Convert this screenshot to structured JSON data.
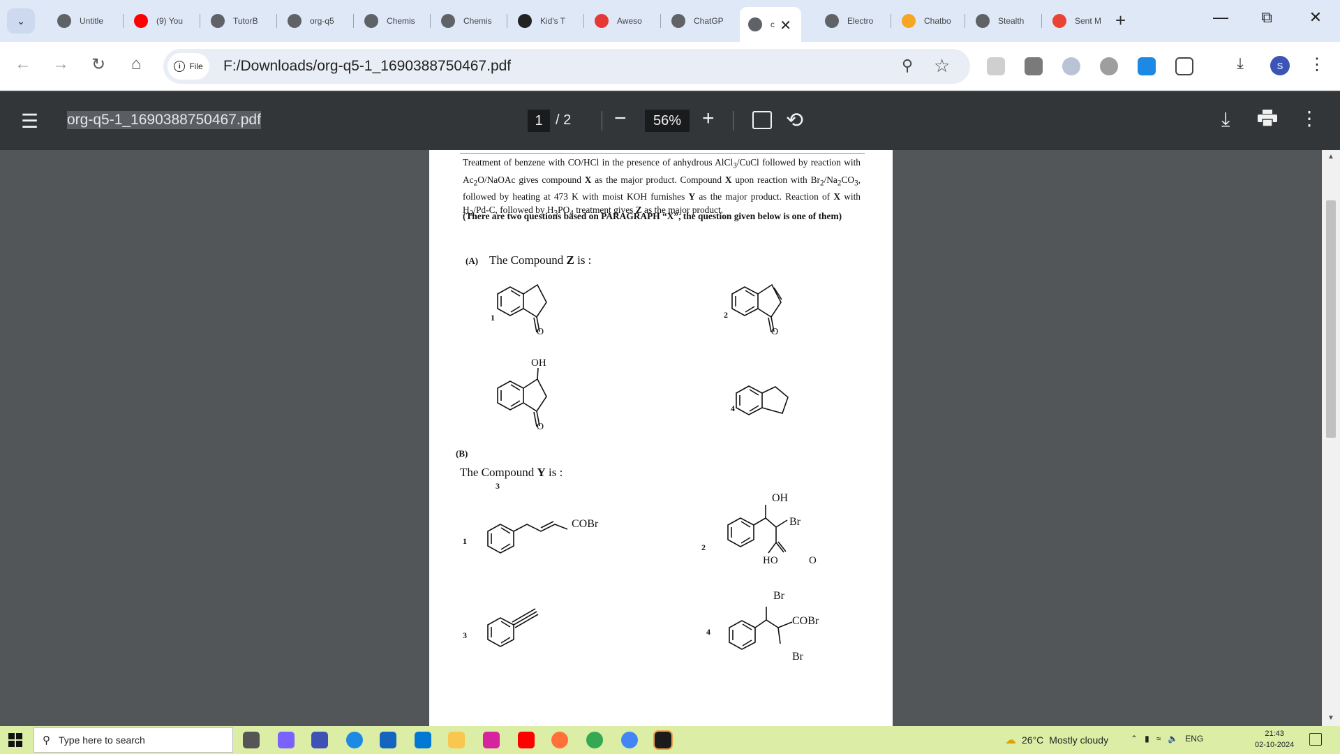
{
  "browser": {
    "tabs": [
      {
        "label": "Untitle",
        "icon": "globe-icon",
        "color": "#5f6368"
      },
      {
        "label": "(9) You",
        "icon": "youtube-icon",
        "color": "#ff0000"
      },
      {
        "label": "TutorB",
        "icon": "tutor-icon",
        "color": "#5f6368"
      },
      {
        "label": "org-q5",
        "icon": "globe-icon",
        "color": "#5f6368"
      },
      {
        "label": "Chemis",
        "icon": "globe-icon",
        "color": "#5f6368"
      },
      {
        "label": "Chemis",
        "icon": "globe-icon",
        "color": "#5f6368"
      },
      {
        "label": "Kid's T",
        "icon": "kids-icon",
        "color": "#222222"
      },
      {
        "label": "Aweso",
        "icon": "awesome-icon",
        "color": "#e53935"
      },
      {
        "label": "ChatGP",
        "icon": "openai-icon",
        "color": "#5f6368"
      },
      {
        "label": "c",
        "icon": "globe-icon",
        "color": "#5f6368"
      },
      {
        "label": "Electro",
        "icon": "globe-icon",
        "color": "#5f6368"
      },
      {
        "label": "Chatbo",
        "icon": "chatbot-icon",
        "color": "#f5a623"
      },
      {
        "label": "Stealth",
        "icon": "stealth-icon",
        "color": "#5f6368"
      },
      {
        "label": "Sent M",
        "icon": "gmail-icon",
        "color": "#ea4335"
      }
    ],
    "active_tab_close": "✕",
    "new_tab": "+",
    "site_info_label": "File",
    "url": "F:/Downloads/org-q5-1_1690388750467.pdf",
    "profile_initial": "S"
  },
  "pdf_viewer": {
    "filename": "org-q5-1_1690388750467.pdf",
    "page_current": "1",
    "page_total": "/ 2",
    "zoom": "56%"
  },
  "document": {
    "paragraph_html": "Treatment of benzene with CO/HCl in the presence of anhydrous AlCl<sub>3</sub>/CuCl followed by reaction with Ac<sub>2</sub>O/NaOAc gives compound <b>X</b> as the major product. Compound <b>X</b> upon reaction with Br<sub>2</sub>/Na<sub>2</sub>CO<sub>3</sub>, followed by heating at 473 K with moist KOH furnishes <b>Y</b> as the major product. Reaction of <b>X</b> with H<sub>2</sub>/Pd-C, followed by H<sub>3</sub>PO<sub>4</sub> treatment gives <b>Z</b> as the major product.",
    "note": "(There are two questions based on PARAGRAPH “X”, the question given below is one of them)",
    "question_a": {
      "label": "(A)",
      "text_prefix": "The Compound ",
      "compound": "Z",
      "text_suffix": " is :",
      "options": [
        "1",
        "2",
        "3",
        "4"
      ],
      "oh": "OH",
      "o": "O"
    },
    "question_b": {
      "label": "(B)",
      "text_prefix": "The Compound ",
      "compound": "Y",
      "text_suffix": " is :",
      "options": [
        "1",
        "2",
        "3",
        "4"
      ],
      "cobr": "COBr",
      "oh": "OH",
      "br": "Br",
      "ho": "HO",
      "o": "O"
    }
  },
  "taskbar": {
    "search_placeholder": "Type here to search",
    "weather_temp": "26°C",
    "weather_text": "Mostly cloudy",
    "language": "ENG",
    "time": "21:43",
    "date": "02-10-2024"
  }
}
